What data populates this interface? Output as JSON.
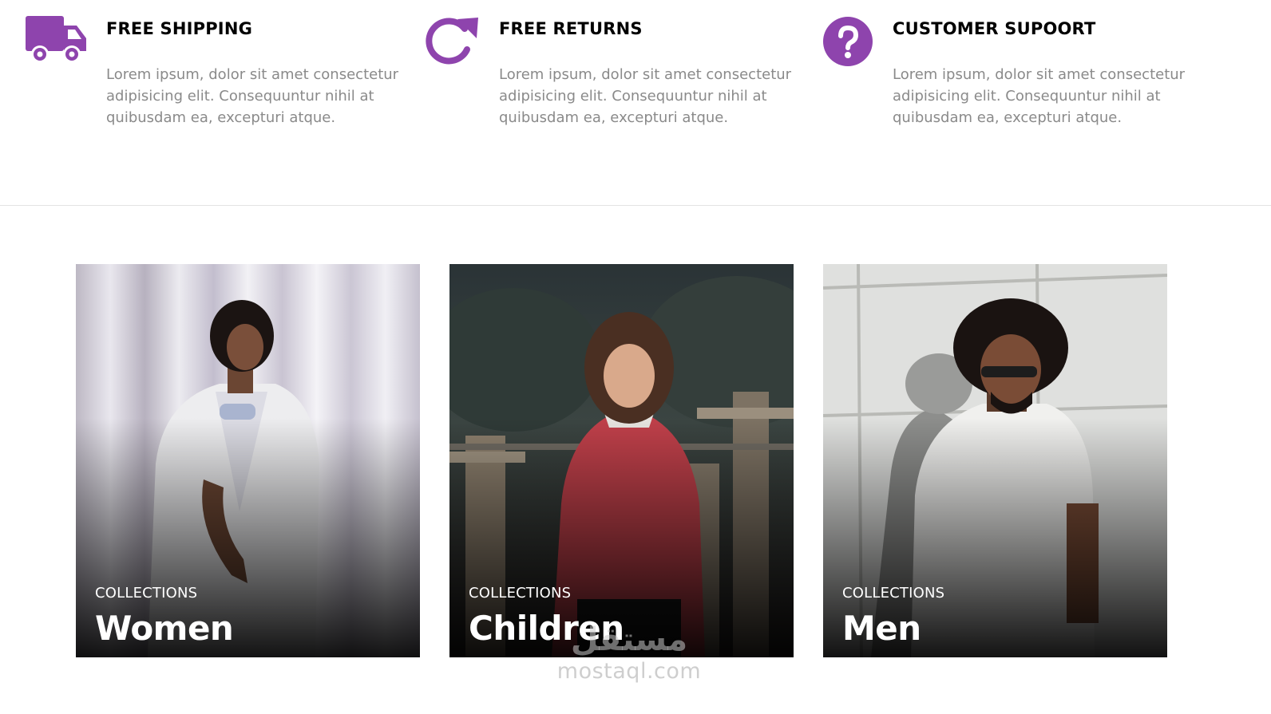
{
  "colors": {
    "accent": "#8e44ad",
    "title_text": "#000000",
    "body_text": "#8a8a8a",
    "divider": "#e3e3e3",
    "overlay_text": "#ffffff"
  },
  "features": [
    {
      "icon": "truck-icon",
      "title": "FREE SHIPPING",
      "description": "Lorem ipsum, dolor sit amet consectetur adipisicing elit. Consequuntur nihil at quibusdam ea, excepturi atque."
    },
    {
      "icon": "refresh-arrow-icon",
      "title": "FREE RETURNS",
      "description": "Lorem ipsum, dolor sit amet consectetur adipisicing elit. Consequuntur nihil at quibusdam ea, excepturi atque."
    },
    {
      "icon": "question-circle-icon",
      "title": "CUSTOMER SUPOORT",
      "description": "Lorem ipsum, dolor sit amet consectetur adipisicing elit. Consequuntur nihil at quibusdam ea, excepturi atque."
    }
  ],
  "collections": [
    {
      "eyebrow": "COLLECTIONS",
      "name": "Women"
    },
    {
      "eyebrow": "COLLECTIONS",
      "name": "Children"
    },
    {
      "eyebrow": "COLLECTIONS",
      "name": "Men"
    }
  ],
  "watermark": {
    "arabic": "مستقل",
    "latin": "mostaql.com"
  }
}
